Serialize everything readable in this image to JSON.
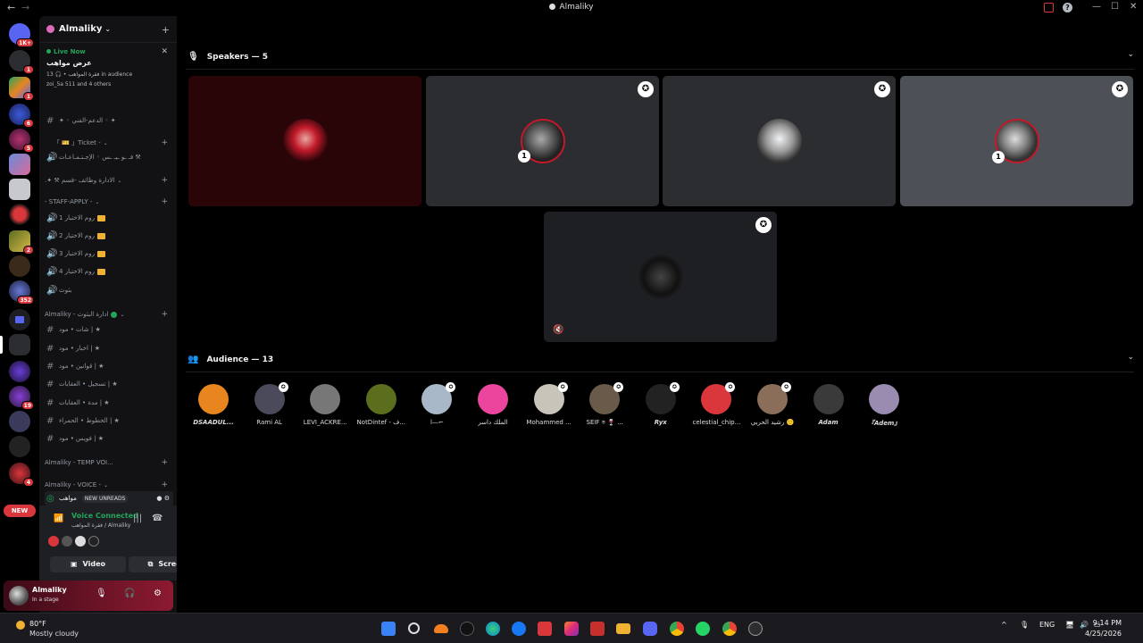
{
  "window": {
    "title": "Almaliky",
    "back_glyph": "←",
    "forward_glyph": "→",
    "minimize_glyph": "—",
    "maximize_glyph": "☐",
    "close_glyph": "✕",
    "help_glyph": "?"
  },
  "rail": {
    "badges": [
      "1K+",
      "1",
      "1",
      "6",
      "5",
      "2",
      "352",
      "19",
      "4"
    ],
    "new_pill": "NEW"
  },
  "server": {
    "name": "Almaliky",
    "chevron": "⌄",
    "add_member_glyph": "+"
  },
  "live": {
    "label": "Live Now",
    "close_glyph": "✕",
    "stage_title": "عرض مواهب",
    "meta": "فقرة المواهب • 🎧 13 in audience",
    "speakers_line": "zoi_5a 511 and 4 others"
  },
  "channels": [
    {
      "kind": "text",
      "label": "✦ ◦ الدعم-الفني ◦ ✦"
    },
    {
      "kind": "category",
      "label": "「 🎫 」Ticket -"
    },
    {
      "kind": "voice",
      "label": "فـ ـو ـيـ ـس ◦ الإجـتـمـاعـات ⚒"
    },
    {
      "kind": "category",
      "label": ".✦ ⚒ الادارة وظائف -قسم"
    },
    {
      "kind": "category",
      "label": "- STAFF-APPLY -"
    },
    {
      "kind": "voice",
      "label": "روم الاختبار 1",
      "folder": true
    },
    {
      "kind": "voice",
      "label": "روم الاختبار 2",
      "folder": true
    },
    {
      "kind": "voice",
      "label": "روم الاختبار 3",
      "folder": true
    },
    {
      "kind": "voice",
      "label": "روم الاختبار 4",
      "folder": true
    },
    {
      "kind": "voice",
      "label": "بثوث"
    },
    {
      "kind": "category",
      "label": "Almaliky - ادارة البثوث"
    },
    {
      "kind": "text",
      "label": "شات • مود | ★"
    },
    {
      "kind": "text",
      "label": "اخبار • مود | ★"
    },
    {
      "kind": "text",
      "label": "قوانين • مود | ★"
    },
    {
      "kind": "text",
      "label": "تسجيل • العقابات | ★"
    },
    {
      "kind": "text",
      "label": "مدة • العقابات | ★"
    },
    {
      "kind": "text",
      "label": "الخطوط • الحمراء | ★"
    },
    {
      "kind": "text",
      "label": "فويس • مود | ★"
    },
    {
      "kind": "category",
      "label": "Almaliky - TEMP VOI..."
    },
    {
      "kind": "category",
      "label": "Almaliky - VOICE -"
    },
    {
      "kind": "stage",
      "label": "مواهب"
    }
  ],
  "new_unreads": "NEW UNREADS",
  "voice": {
    "title": "Voice Connected",
    "subtitle": "فقرة المواهب / Almaliky",
    "video_label": "Video",
    "screen_label": "Screen"
  },
  "user": {
    "name": "Almaliky",
    "status": "In a stage"
  },
  "stage": {
    "speakers_header": "Speakers — 5",
    "audience_header": "Audience — 13",
    "chevron": "⌄",
    "mod_glyph": "✪",
    "mute_glyph": "🔇",
    "speaker_badge": "1",
    "audience": [
      {
        "name": "DSAADUL...",
        "italic": true,
        "color": "#e8851f"
      },
      {
        "name": "Rami AL",
        "color": "#4a4a5a"
      },
      {
        "name": "LEVI_ACKRE...",
        "color": "#777"
      },
      {
        "name": "NotDintef - ف...",
        "color": "#5b6e1e"
      },
      {
        "name": "ا—⌐",
        "color": "#a8b8c8"
      },
      {
        "name": "الملك داسر",
        "color": "#eb459e"
      },
      {
        "name": "Mohammed ...",
        "color": "#c9c4ba"
      },
      {
        "name": "SEIF ⍟ 🍷 ...",
        "color": "#6a5a4a"
      },
      {
        "name": "Ryx",
        "italic": true,
        "color": "#222"
      },
      {
        "name": "celestial_chip...",
        "color": "#da373c"
      },
      {
        "name": "رشيد الحربي 🙂",
        "color": "#8a6e5a"
      },
      {
        "name": "Adam",
        "italic": true,
        "color": "#3a3a3a"
      },
      {
        "name": "『Adem』",
        "italic": true,
        "color": "#9a8bb0"
      }
    ]
  },
  "taskbar": {
    "temp": "80°F",
    "weather": "Mostly cloudy",
    "lang": "ENG",
    "time": "9:14 PM",
    "date": "4/25/2026"
  }
}
